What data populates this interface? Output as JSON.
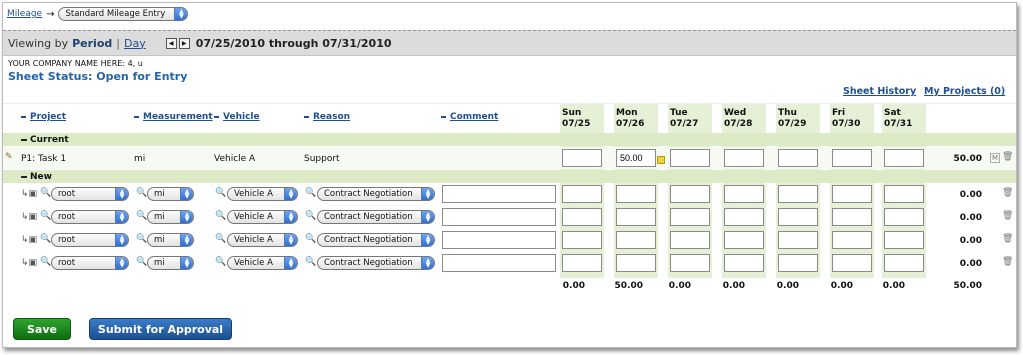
{
  "breadcrumb": {
    "mileage_link": "Mileage",
    "arrow": "→",
    "entry_select": "Standard Mileage Entry"
  },
  "viewbar": {
    "viewing_by": "Viewing by",
    "period": "Period",
    "separator": "|",
    "day_link": "Day",
    "date_range": "07/25/2010 through 07/31/2010"
  },
  "company": "YOUR COMPANY NAME HERE: 4, u",
  "sheet_status": "Sheet Status: Open for Entry",
  "links": {
    "sheet_history": "Sheet History",
    "my_projects": "My Projects (0)"
  },
  "columns": {
    "project": "Project",
    "measurement": "Measurement",
    "vehicle": "Vehicle",
    "reason": "Reason",
    "comment": "Comment"
  },
  "days": [
    {
      "name": "Sun",
      "date": "07/25"
    },
    {
      "name": "Mon",
      "date": "07/26"
    },
    {
      "name": "Tue",
      "date": "07/27"
    },
    {
      "name": "Wed",
      "date": "07/28"
    },
    {
      "name": "Thu",
      "date": "07/29"
    },
    {
      "name": "Fri",
      "date": "07/30"
    },
    {
      "name": "Sat",
      "date": "07/31"
    }
  ],
  "sections": {
    "current": "Current",
    "new": "New"
  },
  "current_row": {
    "project": "P1: Task 1",
    "measurement": "mi",
    "vehicle": "Vehicle A",
    "reason": "Support",
    "values": [
      "",
      "50.00",
      "",
      "",
      "",
      "",
      ""
    ],
    "total": "50.00",
    "m_label": "M"
  },
  "new_rows": [
    {
      "project": "root",
      "measurement": "mi",
      "vehicle": "Vehicle A",
      "reason": "Contract Negotiation",
      "total": "0.00"
    },
    {
      "project": "root",
      "measurement": "mi",
      "vehicle": "Vehicle A",
      "reason": "Contract Negotiation",
      "total": "0.00"
    },
    {
      "project": "root",
      "measurement": "mi",
      "vehicle": "Vehicle A",
      "reason": "Contract Negotiation",
      "total": "0.00"
    },
    {
      "project": "root",
      "measurement": "mi",
      "vehicle": "Vehicle A",
      "reason": "Contract Negotiation",
      "total": "0.00"
    }
  ],
  "day_totals": [
    "0.00",
    "50.00",
    "0.00",
    "0.00",
    "0.00",
    "0.00",
    "0.00"
  ],
  "grand_total": "50.00",
  "buttons": {
    "save": "Save",
    "submit": "Submit for Approval"
  }
}
